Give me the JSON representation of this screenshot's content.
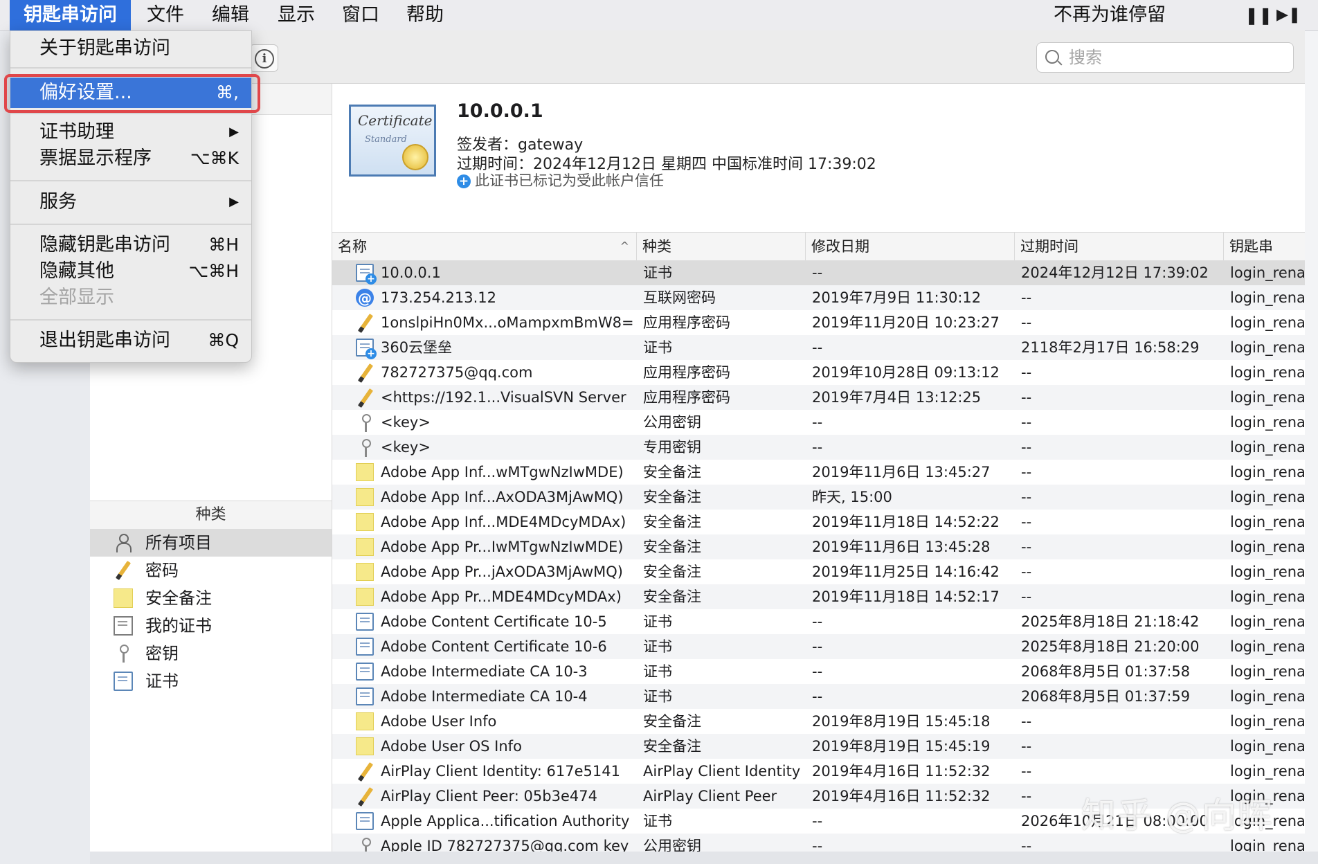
{
  "menubar": {
    "app": "钥匙串访问",
    "items": [
      "文件",
      "编辑",
      "显示",
      "窗口",
      "帮助"
    ],
    "now_playing": "不再为谁停留",
    "pause_glyph": "❚❚",
    "next_glyph": "▶❚"
  },
  "app_menu": {
    "about": "关于钥匙串访问",
    "preferences": "偏好设置...",
    "preferences_shortcut": "⌘,",
    "cert_assistant": "证书助理",
    "ticket_viewer": "票据显示程序",
    "ticket_viewer_shortcut": "⌥⌘K",
    "services": "服务",
    "submenu_arrow": "▶",
    "hide_app": "隐藏钥匙串访问",
    "hide_app_shortcut": "⌘H",
    "hide_others": "隐藏其他",
    "hide_others_shortcut": "⌥⌘H",
    "show_all": "全部显示",
    "quit": "退出钥匙串访问",
    "quit_shortcut": "⌘Q"
  },
  "toolbar": {
    "info_glyph": "i",
    "search_placeholder": "搜索"
  },
  "sidebar": {
    "category_header": "种类",
    "categories": [
      {
        "label": "所有项目",
        "icon": "person-icon"
      },
      {
        "label": "密码",
        "icon": "pen-icon"
      },
      {
        "label": "安全备注",
        "icon": "note-icon"
      },
      {
        "label": "我的证书",
        "icon": "my-cert-icon"
      },
      {
        "label": "密钥",
        "icon": "key-icon"
      },
      {
        "label": "证书",
        "icon": "certificate-icon"
      }
    ]
  },
  "detail": {
    "cert_word1": "Certificate",
    "cert_word2": "Standard",
    "title": "10.0.0.1",
    "issuer": "签发者：gateway",
    "expiry": "过期时间：2024年12月12日 星期四 中国标准时间 17:39:02",
    "trust_glyph": "+",
    "trust": "此证书已标记为受此帐户信任"
  },
  "table": {
    "sort_arrow": "^",
    "columns": [
      "名称",
      "种类",
      "修改日期",
      "过期时间",
      "钥匙串"
    ],
    "rows": [
      {
        "icon": "cert-plus",
        "name": "10.0.0.1",
        "kind": "证书",
        "modified": "--",
        "expires": "2024年12月12日 17:39:02",
        "keychain": "login_rena"
      },
      {
        "icon": "at",
        "name": "173.254.213.12",
        "kind": "互联网密码",
        "modified": "2019年7月9日 11:30:12",
        "expires": "--",
        "keychain": "login_rena"
      },
      {
        "icon": "pen",
        "name": "1onslpiHn0Mx...oMampxmBmW8=",
        "kind": "应用程序密码",
        "modified": "2019年11月20日 10:23:27",
        "expires": "--",
        "keychain": "login_rena"
      },
      {
        "icon": "cert-plus",
        "name": "360云堡垒",
        "kind": "证书",
        "modified": "--",
        "expires": "2118年2月17日 16:58:29",
        "keychain": "login_rena"
      },
      {
        "icon": "pen",
        "name": "782727375@qq.com",
        "kind": "应用程序密码",
        "modified": "2019年10月28日 09:13:12",
        "expires": "--",
        "keychain": "login_rena"
      },
      {
        "icon": "pen",
        "name": "<https://192.1...VisualSVN Server",
        "kind": "应用程序密码",
        "modified": "2019年7月4日 13:12:25",
        "expires": "--",
        "keychain": "login_rena"
      },
      {
        "icon": "key",
        "name": "<key>",
        "kind": "公用密钥",
        "modified": "--",
        "expires": "--",
        "keychain": "login_rena"
      },
      {
        "icon": "key",
        "name": "<key>",
        "kind": "专用密钥",
        "modified": "--",
        "expires": "--",
        "keychain": "login_rena"
      },
      {
        "icon": "note",
        "name": "Adobe App Inf...wMTgwNzIwMDE)",
        "kind": "安全备注",
        "modified": "2019年11月6日 13:45:27",
        "expires": "--",
        "keychain": "login_rena"
      },
      {
        "icon": "note",
        "name": "Adobe App Inf...AxODA3MjAwMQ)",
        "kind": "安全备注",
        "modified": "昨天, 15:00",
        "expires": "--",
        "keychain": "login_rena"
      },
      {
        "icon": "note",
        "name": "Adobe App Inf...MDE4MDcyMDAx)",
        "kind": "安全备注",
        "modified": "2019年11月18日 14:52:22",
        "expires": "--",
        "keychain": "login_rena"
      },
      {
        "icon": "note",
        "name": "Adobe App Pr...IwMTgwNzIwMDE)",
        "kind": "安全备注",
        "modified": "2019年11月6日 13:45:28",
        "expires": "--",
        "keychain": "login_rena"
      },
      {
        "icon": "note",
        "name": "Adobe App Pr...jAxODA3MjAwMQ)",
        "kind": "安全备注",
        "modified": "2019年11月25日 14:16:42",
        "expires": "--",
        "keychain": "login_rena"
      },
      {
        "icon": "note",
        "name": "Adobe App Pr...MDE4MDcyMDAx)",
        "kind": "安全备注",
        "modified": "2019年11月18日 14:52:17",
        "expires": "--",
        "keychain": "login_rena"
      },
      {
        "icon": "cert",
        "name": "Adobe Content Certificate 10-5",
        "kind": "证书",
        "modified": "--",
        "expires": "2025年8月18日 21:18:42",
        "keychain": "login_rena"
      },
      {
        "icon": "cert",
        "name": "Adobe Content Certificate 10-6",
        "kind": "证书",
        "modified": "--",
        "expires": "2025年8月18日 21:20:00",
        "keychain": "login_rena"
      },
      {
        "icon": "cert",
        "name": "Adobe Intermediate CA 10-3",
        "kind": "证书",
        "modified": "--",
        "expires": "2068年8月5日 01:37:58",
        "keychain": "login_rena"
      },
      {
        "icon": "cert",
        "name": "Adobe Intermediate CA 10-4",
        "kind": "证书",
        "modified": "--",
        "expires": "2068年8月5日 01:37:59",
        "keychain": "login_rena"
      },
      {
        "icon": "note",
        "name": "Adobe User Info",
        "kind": "安全备注",
        "modified": "2019年8月19日 15:45:18",
        "expires": "--",
        "keychain": "login_renat"
      },
      {
        "icon": "note",
        "name": "Adobe User OS Info",
        "kind": "安全备注",
        "modified": "2019年8月19日 15:45:19",
        "expires": "--",
        "keychain": "login_rena"
      },
      {
        "icon": "pen",
        "name": "AirPlay Client Identity: 617e5141",
        "kind": "AirPlay Client Identity",
        "modified": "2019年4月16日 11:52:32",
        "expires": "--",
        "keychain": "login_rena"
      },
      {
        "icon": "pen",
        "name": "AirPlay Client Peer: 05b3e474",
        "kind": "AirPlay Client Peer",
        "modified": "2019年4月16日 11:52:32",
        "expires": "--",
        "keychain": "login_rena"
      },
      {
        "icon": "cert",
        "name": "Apple Applica...tification Authority",
        "kind": "证书",
        "modified": "--",
        "expires": "2026年10月21日 08:00:00",
        "keychain": "login_rena"
      },
      {
        "icon": "key",
        "name": "Apple ID 782727375@qq.com key",
        "kind": "公用密钥",
        "modified": "--",
        "expires": "--",
        "keychain": "login_rena"
      }
    ]
  },
  "watermark": "知乎 @向晖"
}
